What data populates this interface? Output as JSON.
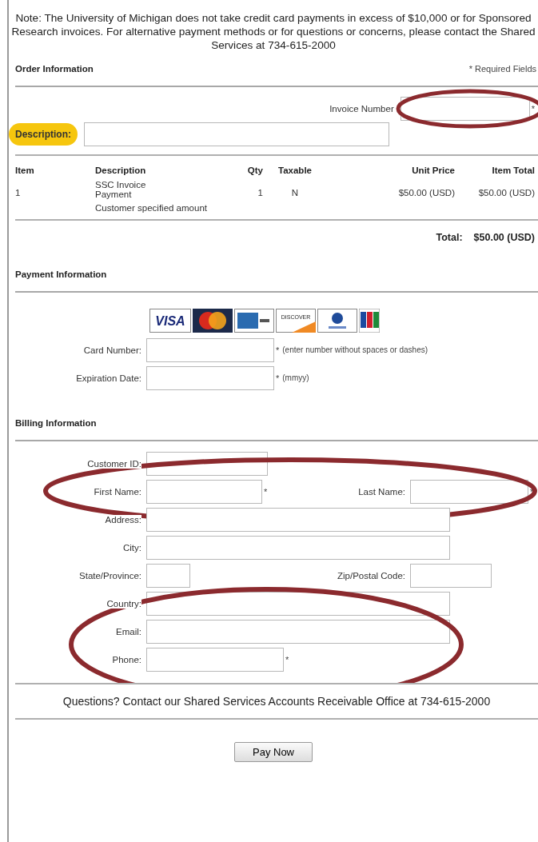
{
  "note": "Note: The University of Michigan does not take credit card payments in excess of $10,000 or for Sponsored Research invoices. For alternative payment methods or for questions or concerns, please contact the Shared Services at 734-615-2000",
  "order_information": {
    "heading": "Order Information",
    "required_note": "* Required Fields",
    "invoice_field": {
      "label": "Invoice Number",
      "required_mark": "*",
      "circled": true
    },
    "description_field": {
      "label": "Description:",
      "highlighted": true
    }
  },
  "items_table": {
    "columns": [
      "Item",
      "Description",
      "Qty",
      "Taxable",
      "Unit Price",
      "Item Total"
    ],
    "rows": [
      {
        "item": "1",
        "description": "SSC Invoice Payment",
        "detail": "Customer specified amount",
        "qty": "1",
        "taxable": "N",
        "unit_price": "$50.00 (USD)",
        "item_total": "$50.00 (USD)"
      }
    ]
  },
  "total": {
    "label": "Total:",
    "value": "$50.00 (USD)"
  },
  "payment_information": {
    "heading": "Payment Information",
    "card_logos": [
      {
        "kind": "visa",
        "label": "VISA"
      },
      {
        "kind": "mastercard"
      },
      {
        "kind": "amex"
      },
      {
        "kind": "discover",
        "label": "DISCOVER"
      },
      {
        "kind": "diners"
      },
      {
        "kind": "jcb"
      }
    ],
    "fields": [
      {
        "label": "Card Number:",
        "required_mark": "*",
        "hint": "(enter number without spaces or dashes)"
      },
      {
        "label": "Expiration Date:",
        "required_mark": "*",
        "hint": "(mmyy)"
      }
    ]
  },
  "billing_information": {
    "heading": "Billing Information",
    "groups": [
      {
        "circled": false,
        "rows": [
          [
            {
              "label": "Customer ID:"
            }
          ]
        ]
      },
      {
        "circled": true,
        "rows": [
          [
            {
              "label": "First Name:",
              "required_mark": "*"
            },
            {
              "label": "Last Name:",
              "required_mark": "*"
            }
          ]
        ]
      },
      {
        "circled": false,
        "rows": [
          [
            {
              "label": "Address:"
            }
          ],
          [
            {
              "label": "City:"
            }
          ],
          [
            {
              "label": "State/Province:"
            },
            {
              "label": "Zip/Postal Code:"
            }
          ],
          [
            {
              "label": "Country:"
            }
          ]
        ]
      },
      {
        "circled": true,
        "rows": [
          [
            {
              "label": "Email:"
            }
          ],
          [
            {
              "label": "Phone:",
              "required_mark": "*"
            }
          ]
        ]
      }
    ]
  },
  "footer_note": "Questions? Contact our Shared Services Accounts Receivable Office at 734-615-2000",
  "pay_button": "Pay Now"
}
